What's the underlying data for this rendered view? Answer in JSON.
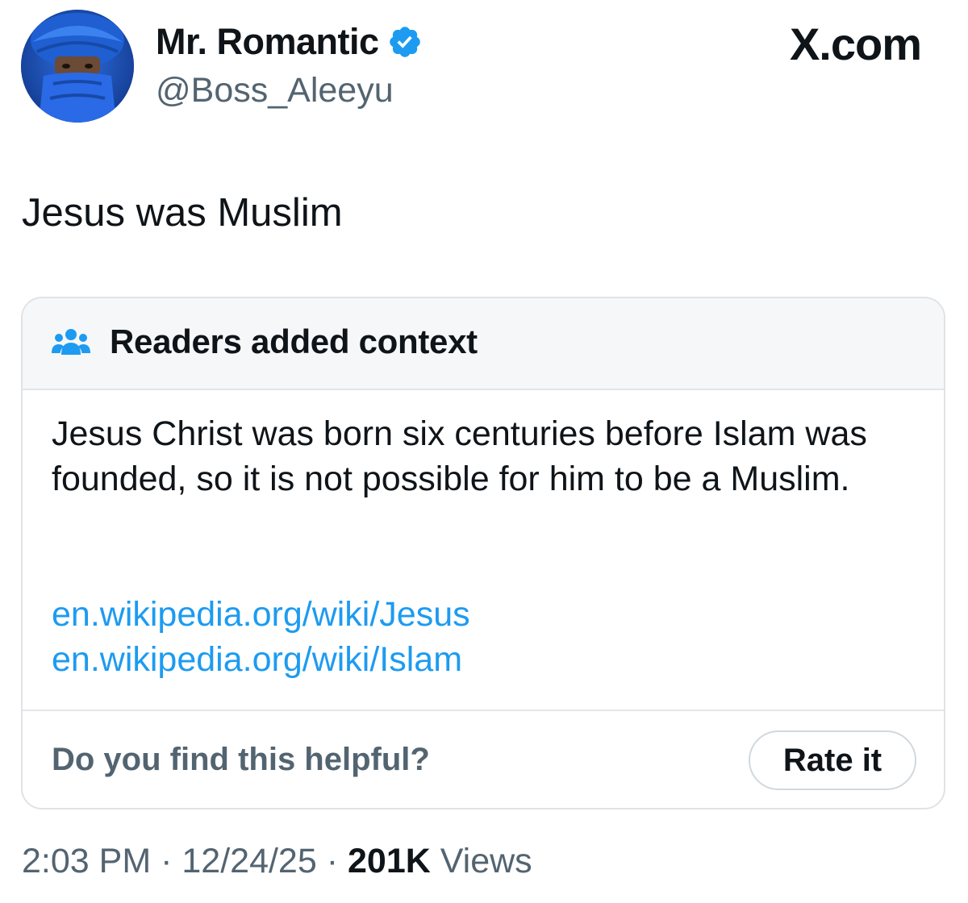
{
  "author": {
    "name": "Mr. Romantic",
    "handle": "@Boss_Aleeyu",
    "avatar_icon": "profile-photo-blue-turban",
    "verified_icon": "verified-badge-icon",
    "verified_color": "#1d9bf0"
  },
  "site": {
    "mark": "X.com"
  },
  "tweet": {
    "text": "Jesus was Muslim"
  },
  "community_note": {
    "icon": "people-icon",
    "title": "Readers added context",
    "body": "Jesus Christ was born six centuries before Islam was founded, so it is not possible for him to be a Muslim.",
    "links": [
      "en.wikipedia.org/wiki/Jesus",
      "en.wikipedia.org/wiki/Islam"
    ],
    "link_color": "#1d9bf0",
    "helpful_question": "Do you find this helpful?",
    "rate_label": "Rate it"
  },
  "meta": {
    "time": "2:03 PM",
    "separator": "·",
    "date": "12/24/25",
    "views_count": "201K",
    "views_label": "Views"
  }
}
